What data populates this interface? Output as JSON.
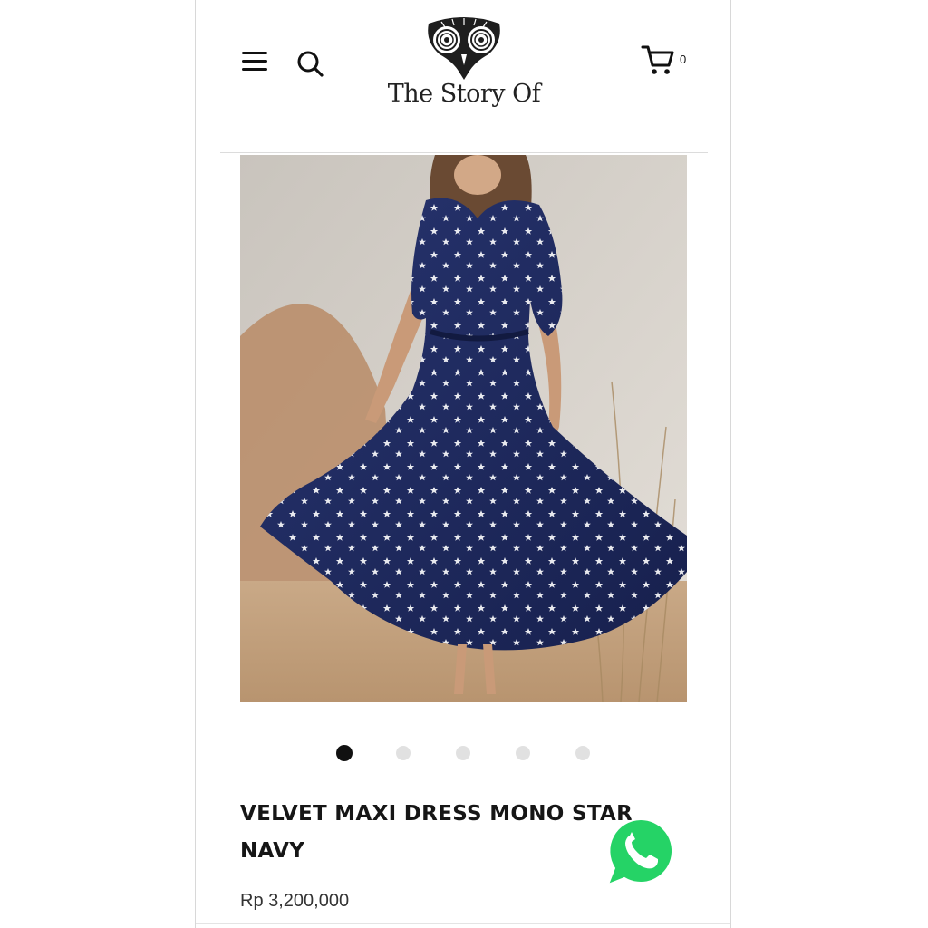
{
  "header": {
    "brand_name": "The Story Of",
    "cart_count": "0",
    "menu_icon": "hamburger-menu-icon",
    "search_icon": "search-icon",
    "cart_icon": "shopping-cart-icon"
  },
  "product": {
    "title": "VELVET MAXI DRESS MONO STAR NAVY",
    "price": "Rp 3,200,000",
    "image_count": 5,
    "active_image": 1
  },
  "floating": {
    "whatsapp_icon": "whatsapp-chat-icon",
    "whatsapp_color": "#25D366"
  },
  "colors": {
    "dress_navy": "#1f2b63",
    "text_dark": "#161616"
  }
}
